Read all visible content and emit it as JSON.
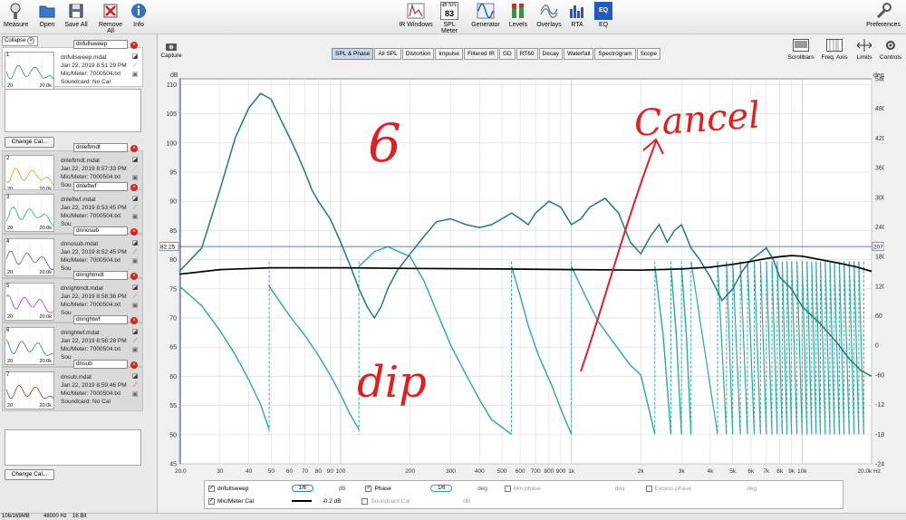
{
  "toolbar": {
    "left_buttons": [
      {
        "label": "Measure",
        "icon": "measure-icon"
      },
      {
        "label": "Open",
        "icon": "folder-icon"
      },
      {
        "label": "Save All",
        "icon": "save-icon"
      },
      {
        "label": "Remove All",
        "icon": "remove-icon"
      },
      {
        "label": "Info",
        "icon": "info-icon"
      }
    ],
    "center_buttons": [
      {
        "label": "IR Windows",
        "icon": "ir-windows-icon"
      },
      {
        "label": "SPL Meter",
        "icon": "spl-meter-icon",
        "badge_top": "dB SPL",
        "badge_value": "83"
      },
      {
        "label": "Generator",
        "icon": "generator-icon"
      },
      {
        "label": "Levels",
        "icon": "levels-icon"
      },
      {
        "label": "Overlays",
        "icon": "overlays-icon"
      },
      {
        "label": "RTA",
        "icon": "rta-icon"
      },
      {
        "label": "EQ",
        "icon": "eq-icon"
      }
    ],
    "preferences": {
      "label": "Preferences",
      "icon": "wrench-icon"
    }
  },
  "left_panel": {
    "collapse_label": "Collapse",
    "change_cal_label": "Change Cal...",
    "measurements": [
      {
        "num": "1",
        "name": "dnfullsweep",
        "file": "dnfullsweep.mdat",
        "date": "Jan 22, 2019 8:51:29 PM",
        "mic": "Mic/Meter: 7000504.txt",
        "sound": "Soundcard: No Cal",
        "lx": "20",
        "rx": "20.0k",
        "color": "#2a8c8c"
      },
      {
        "num": "2",
        "name": "dnleftmdt",
        "file": "dnleftmdt.mdat",
        "date": "Jan 22, 2019 8:57:33 PM",
        "mic": "Mic/Meter: 7000504.txt",
        "sound": "Sou",
        "lx": "20",
        "rx": "20.0k",
        "color": "#c9a227"
      },
      {
        "num": "3",
        "name": "dnleftwf",
        "file": "dnleftwf.mdat",
        "date": "Jan 22, 2019 8:53:45 PM",
        "mic": "Mic/Meter: 7000504.txt",
        "sound": "Sou",
        "lx": "20",
        "rx": "20.0k",
        "color": "#27a572"
      },
      {
        "num": "4",
        "name": "dnnosub",
        "file": "dnnosub.mdat",
        "date": "Jan 22, 2019 8:52:45 PM",
        "mic": "Mic/Meter: 7000504.txt",
        "sound": "Sou",
        "lx": "20",
        "rx": "20.0k",
        "color": "#8b3fb5"
      },
      {
        "num": "5",
        "name": "dnrightmdt",
        "file": "dnrightmdt.mdat",
        "date": "Jan 22, 2019 8:58:36 PM",
        "mic": "Mic/Meter: 7000504.txt",
        "sound": "Sou",
        "lx": "20",
        "rx": "20.0k",
        "color": "#b13fa6"
      },
      {
        "num": "6",
        "name": "dnrightwf",
        "file": "dnrightwf.mdat",
        "date": "Jan 22, 2019 8:56:28 PM",
        "mic": "Mic/Meter: 7000504.txt",
        "sound": "Sou",
        "lx": "20",
        "rx": "20.0k",
        "color": "#3b6fb8"
      },
      {
        "num": "7",
        "name": "dnsub",
        "file": "dnsub.mdat",
        "date": "Jan 22, 2019 8:59:46 PM",
        "mic": "Mic/Meter: 7000504.txt",
        "sound": "Soundcard: No Cal",
        "lx": "20",
        "rx": "20.0k",
        "color": "#b52a2a"
      }
    ]
  },
  "capture_label": "Capture",
  "tabs": [
    "SPL & Phase",
    "All SPL",
    "Distortion",
    "Impulse",
    "Filtered IR",
    "GD",
    "RT60",
    "Decay",
    "Waterfall",
    "Spectrogram",
    "Scope"
  ],
  "active_tab": "SPL & Phase",
  "right_controls": [
    {
      "label": "Scrollbars",
      "icon": "scrollbars-icon"
    },
    {
      "label": "Freq. Axis",
      "icon": "freq-axis-icon"
    },
    {
      "label": "Limits",
      "icon": "limits-icon"
    },
    {
      "label": "Controls",
      "icon": "controls-icon"
    }
  ],
  "chart_data": {
    "type": "line",
    "title": "",
    "xlabel": "Hz",
    "ylabel": "dB",
    "y2label": "deg",
    "x_scale": "log",
    "xlim": [
      20,
      20000
    ],
    "ylim": [
      45,
      111
    ],
    "y2lim": [
      -240,
      540
    ],
    "grid": true,
    "x_tick_labels": [
      "20.0",
      "30",
      "40",
      "50",
      "60",
      "70",
      "80",
      "90",
      "100",
      "200",
      "300",
      "400",
      "500",
      "600",
      "700",
      "800",
      "900",
      "1k",
      "2k",
      "3k",
      "4k",
      "5k",
      "6k",
      "7k",
      "8k",
      "9k",
      "10k",
      "20.0k Hz"
    ],
    "y_ticks": [
      45,
      50,
      55,
      60,
      65,
      70,
      75,
      80,
      85,
      90,
      95,
      100,
      105,
      110
    ],
    "y2_ticks": [
      -240,
      -180,
      -120,
      -60,
      0,
      60,
      120,
      180,
      240,
      300,
      360,
      420,
      480,
      540
    ],
    "cursor_left": "82.25",
    "cursor_right": "207",
    "series": [
      {
        "name": "dnfullsweep",
        "color": "#1e7a7e",
        "width": 1.5,
        "points": [
          [
            20,
            78
          ],
          [
            25,
            82
          ],
          [
            30,
            92
          ],
          [
            35,
            101
          ],
          [
            40,
            106
          ],
          [
            45,
            108.5
          ],
          [
            50,
            107.5
          ],
          [
            55,
            104
          ],
          [
            60,
            101
          ],
          [
            65,
            98
          ],
          [
            70,
            95
          ],
          [
            75,
            92
          ],
          [
            80,
            90
          ],
          [
            85,
            88.5
          ],
          [
            90,
            87
          ],
          [
            95,
            85
          ],
          [
            100,
            83
          ],
          [
            110,
            79
          ],
          [
            120,
            75
          ],
          [
            130,
            72
          ],
          [
            140,
            70
          ],
          [
            150,
            72
          ],
          [
            160,
            75
          ],
          [
            175,
            78
          ],
          [
            200,
            81
          ],
          [
            230,
            84
          ],
          [
            260,
            86.5
          ],
          [
            300,
            87
          ],
          [
            350,
            86
          ],
          [
            400,
            85.5
          ],
          [
            450,
            86
          ],
          [
            500,
            87
          ],
          [
            550,
            88
          ],
          [
            600,
            87
          ],
          [
            650,
            86
          ],
          [
            700,
            88
          ],
          [
            800,
            90
          ],
          [
            900,
            89
          ],
          [
            1000,
            86
          ],
          [
            1100,
            87
          ],
          [
            1200,
            89
          ],
          [
            1400,
            90.5
          ],
          [
            1600,
            88
          ],
          [
            1800,
            83
          ],
          [
            2000,
            81
          ],
          [
            2200,
            84
          ],
          [
            2400,
            86
          ],
          [
            2600,
            83
          ],
          [
            2800,
            85
          ],
          [
            3000,
            86
          ],
          [
            3300,
            82
          ],
          [
            3600,
            80
          ],
          [
            4000,
            77
          ],
          [
            4500,
            73
          ],
          [
            5000,
            75
          ],
          [
            5500,
            78
          ],
          [
            6000,
            80
          ],
          [
            6500,
            81
          ],
          [
            7000,
            82
          ],
          [
            7500,
            80
          ],
          [
            8000,
            77
          ],
          [
            9000,
            75
          ],
          [
            10000,
            72
          ],
          [
            12000,
            69
          ],
          [
            14000,
            66
          ],
          [
            16000,
            63
          ],
          [
            18000,
            61
          ],
          [
            20000,
            60
          ]
        ]
      },
      {
        "name": "Mic/Meter Cal",
        "color": "#000000",
        "width": 1.7,
        "points": [
          [
            20,
            77.5
          ],
          [
            30,
            78.3
          ],
          [
            50,
            78.6
          ],
          [
            100,
            78.6
          ],
          [
            200,
            78.5
          ],
          [
            500,
            78.4
          ],
          [
            1000,
            78.3
          ],
          [
            2000,
            78.2
          ],
          [
            3000,
            78.4
          ],
          [
            4000,
            78.7
          ],
          [
            5000,
            79.2
          ],
          [
            6000,
            79.7
          ],
          [
            7000,
            80.2
          ],
          [
            8000,
            80.5
          ],
          [
            9000,
            80.7
          ],
          [
            10000,
            80.6
          ],
          [
            12000,
            80
          ],
          [
            14000,
            79.5
          ],
          [
            17000,
            78.8
          ],
          [
            20000,
            78
          ]
        ]
      }
    ],
    "phase": {
      "name": "dnfullsweep phase",
      "color": "#2aa7a7",
      "segments": [
        [
          [
            20,
            120
          ],
          [
            25,
            80
          ],
          [
            30,
            30
          ],
          [
            35,
            -20
          ],
          [
            40,
            -70
          ],
          [
            45,
            -120
          ],
          [
            49,
            -170
          ]
        ],
        [
          [
            49,
            120
          ],
          [
            60,
            60
          ],
          [
            70,
            20
          ],
          [
            80,
            -20
          ],
          [
            90,
            -60
          ],
          [
            100,
            -100
          ],
          [
            110,
            -140
          ],
          [
            120,
            -170
          ]
        ],
        [
          [
            120,
            160
          ],
          [
            140,
            190
          ],
          [
            160,
            200
          ],
          [
            200,
            180
          ],
          [
            230,
            130
          ],
          [
            260,
            70
          ],
          [
            300,
            0
          ],
          [
            350,
            -60
          ],
          [
            400,
            -110
          ],
          [
            450,
            -150
          ],
          [
            550,
            -180
          ]
        ],
        [
          [
            550,
            160
          ],
          [
            600,
            100
          ],
          [
            650,
            40
          ],
          [
            720,
            -20
          ],
          [
            820,
            -80
          ],
          [
            920,
            -140
          ],
          [
            1000,
            -180
          ]
        ],
        [
          [
            1000,
            160
          ],
          [
            1150,
            100
          ],
          [
            1300,
            50
          ],
          [
            1500,
            10
          ],
          [
            1800,
            -40
          ],
          [
            2000,
            -60
          ],
          [
            2300,
            -180
          ]
        ],
        [
          [
            2300,
            160
          ],
          [
            2500,
            20
          ],
          [
            2700,
            -180
          ]
        ],
        [
          [
            2700,
            160
          ],
          [
            2850,
            20
          ],
          [
            3000,
            -180
          ]
        ],
        [
          [
            3000,
            160
          ],
          [
            3150,
            20
          ],
          [
            3300,
            -180
          ]
        ]
      ]
    },
    "phase_wraps_hz": [
      49,
      120,
      550,
      1000,
      2300,
      2700,
      3000,
      3300,
      4300,
      4700,
      5000,
      5400,
      5800,
      6200,
      6600,
      7000,
      7400,
      7800,
      8200,
      8600,
      9000,
      9500,
      10000,
      10500,
      11000,
      11500,
      12000,
      12600,
      13200,
      13800,
      14500,
      15200,
      16000,
      16800,
      17600,
      18500
    ]
  },
  "annotations": [
    {
      "text": "6",
      "color": "#e02020"
    },
    {
      "text": "Cancel",
      "color": "#e02020"
    },
    {
      "text": "dip",
      "color": "#e02020"
    }
  ],
  "legend": {
    "row1": {
      "name": "dnfullsweep",
      "smoothing": "1/6",
      "spl_unit": "dB",
      "phase_label": "Phase",
      "phase_smoothing": "1/6",
      "phase_unit": "deg",
      "min_phase": "Min phase",
      "min_unit": "deg",
      "excess_phase": "Excess phase",
      "excess_unit": "deg"
    },
    "row2": {
      "name": "Mic/Meter Cal",
      "value": "-0.2 dB",
      "soundcard": "Soundcard Cal",
      "soundcard_unit": "dB"
    }
  },
  "status": {
    "memory": "106/169MB",
    "rate": "48000 Hz",
    "bits": "16 Bit"
  }
}
